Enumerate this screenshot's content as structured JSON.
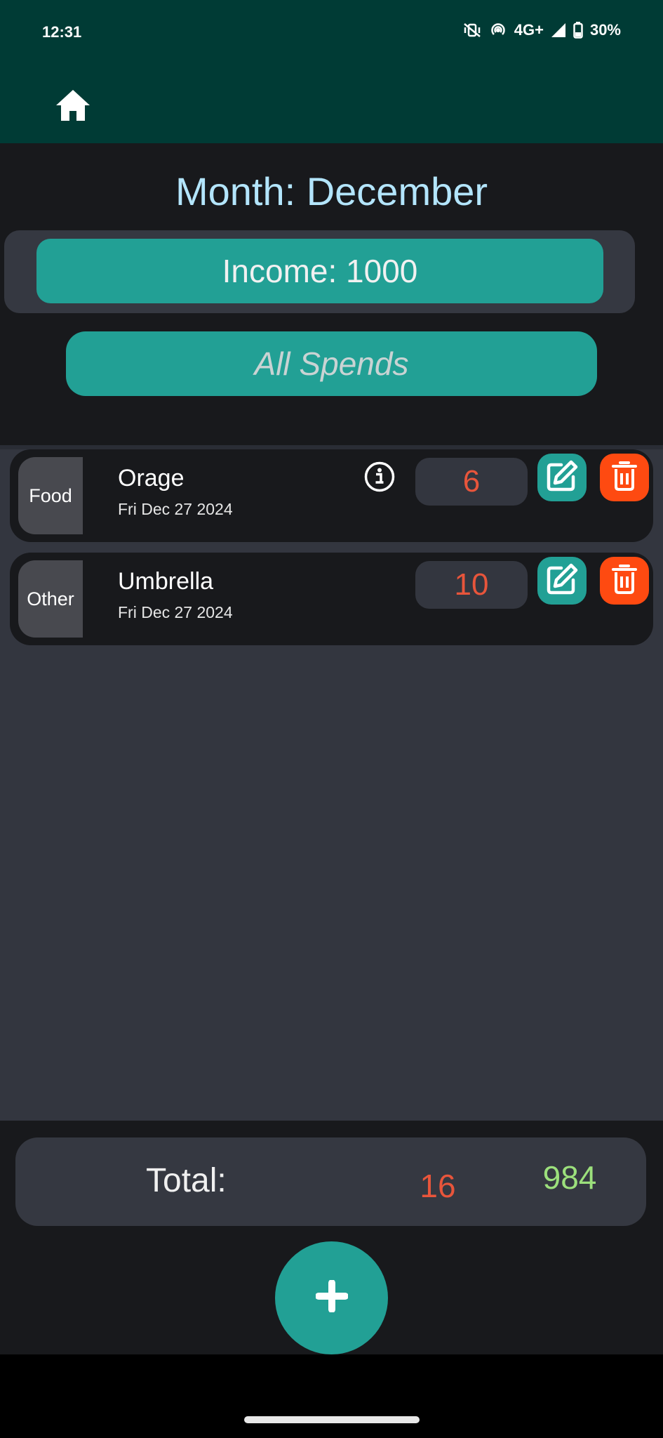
{
  "status_bar": {
    "time": "12:31",
    "network": "4G+",
    "battery": "30%",
    "icons": [
      "mute-vibrate-icon",
      "hotspot-icon",
      "signal-icon",
      "battery-icon"
    ]
  },
  "app_bar": {
    "home_icon": "home-icon"
  },
  "header": {
    "month_title": "Month: December",
    "income_label": "Income: 1000",
    "spends_label": "All Spends"
  },
  "spends": [
    {
      "category": "Food",
      "name": "Orage",
      "date": "Fri Dec 27 2024",
      "amount": "6",
      "has_info": true
    },
    {
      "category": "Other",
      "name": "Umbrella",
      "date": "Fri Dec 27 2024",
      "amount": "10",
      "has_info": false
    }
  ],
  "footer": {
    "total_label": "Total:",
    "total_spent": "16",
    "total_remaining": "984",
    "add_icon": "plus-icon"
  },
  "colors": {
    "app_bar": "#003b35",
    "accent": "#22a095",
    "delete": "#fe4a11",
    "spent": "#e8553b",
    "remaining": "#9ce07c",
    "title": "#b3e5fc"
  }
}
